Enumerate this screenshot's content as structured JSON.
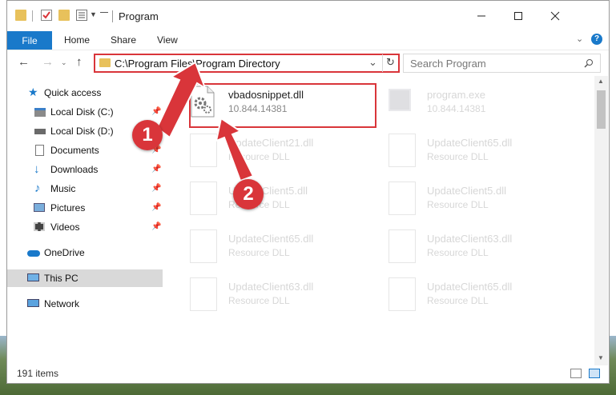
{
  "window": {
    "title": "Program"
  },
  "ribbon": {
    "tabs": [
      "File",
      "Home",
      "Share",
      "View"
    ]
  },
  "address": {
    "path": "C:\\Program Files\\Program Directory"
  },
  "search": {
    "placeholder": "Search Program"
  },
  "sidebar": {
    "items": [
      {
        "label": "Quick access",
        "icon": "star-icon"
      },
      {
        "label": "Local Disk (C:)",
        "icon": "drive-icon"
      },
      {
        "label": "Local Disk (D:)",
        "icon": "drive-icon"
      },
      {
        "label": "Documents",
        "icon": "documents-icon"
      },
      {
        "label": "Downloads",
        "icon": "download-icon"
      },
      {
        "label": "Music",
        "icon": "music-icon"
      },
      {
        "label": "Pictures",
        "icon": "pictures-icon"
      },
      {
        "label": "Videos",
        "icon": "videos-icon"
      },
      {
        "label": "OneDrive",
        "icon": "cloud-icon"
      },
      {
        "label": "This PC",
        "icon": "computer-icon"
      },
      {
        "label": "Network",
        "icon": "network-icon"
      }
    ]
  },
  "files": [
    {
      "name": "vbadosnippet.dll",
      "desc": "10.844.14381"
    },
    {
      "name": "program.exe",
      "desc": "10.844.14381"
    },
    {
      "name": "UpdateClient21.dll",
      "desc": "Resource DLL"
    },
    {
      "name": "UpdateClient65.dll",
      "desc": "Resource DLL"
    },
    {
      "name": "UpdateClient5.dll",
      "desc": "Resource DLL"
    },
    {
      "name": "UpdateClient5.dll",
      "desc": "Resource DLL"
    },
    {
      "name": "UpdateClient65.dll",
      "desc": "Resource DLL"
    },
    {
      "name": "UpdateClient63.dll",
      "desc": "Resource DLL"
    },
    {
      "name": "UpdateClient63.dll",
      "desc": "Resource DLL"
    },
    {
      "name": "UpdateClient65.dll",
      "desc": "Resource DLL"
    }
  ],
  "status": {
    "items": "191 items"
  },
  "annotations": {
    "step1": "1",
    "step2": "2"
  },
  "colors": {
    "accent": "#1979ca",
    "highlight": "#d9353a",
    "folder": "#e8c15b"
  }
}
